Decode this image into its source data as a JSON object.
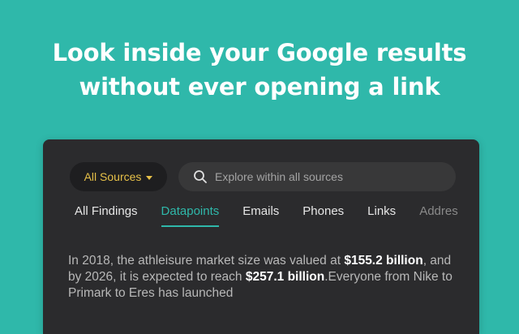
{
  "headline": {
    "line1": "Look inside your Google results",
    "line2": "without ever opening a link"
  },
  "panel": {
    "sources_button": {
      "label": "All Sources",
      "icon": "caret-down-icon"
    },
    "search": {
      "icon": "search-icon",
      "placeholder": "Explore within all sources",
      "value": ""
    },
    "tabs": [
      {
        "label": "All Findings",
        "active": false
      },
      {
        "label": "Datapoints",
        "active": true
      },
      {
        "label": "Emails",
        "active": false
      },
      {
        "label": "Phones",
        "active": false
      },
      {
        "label": "Links",
        "active": false
      },
      {
        "label": "Addres",
        "active": false
      }
    ],
    "snippet": {
      "part1": "In 2018, the athleisure market size was valued at ",
      "highlight1": "$155.2 billion",
      "part2": ", and by 2026, it is expected to reach ",
      "highlight2": "$257.1 billion",
      "part3": ".Everyone from Nike to Primark to Eres has launched"
    }
  },
  "colors": {
    "background": "#2fb8aa",
    "panel": "#2b2b2d",
    "accent_teal": "#2fb8aa",
    "accent_yellow": "#e6c048"
  }
}
